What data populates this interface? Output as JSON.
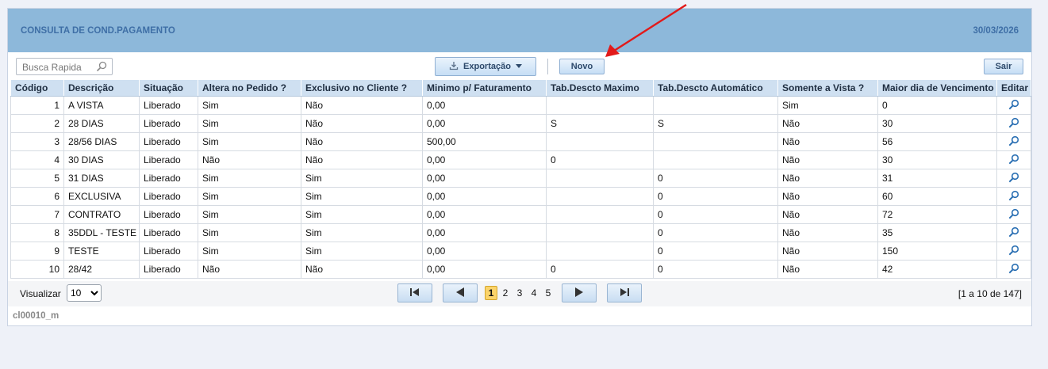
{
  "header": {
    "title": "CONSULTA DE COND.PAGAMENTO",
    "date": "30/03/2026"
  },
  "toolbar": {
    "search_placeholder": "Busca Rapida",
    "export_label": "Exportação",
    "novo_label": "Novo",
    "sair_label": "Sair"
  },
  "table": {
    "columns": [
      "Código",
      "Descrição",
      "Situação",
      "Altera no Pedido ?",
      "Exclusivo no Cliente ?",
      "Minimo p/ Faturamento",
      "Tab.Descto Maximo",
      "Tab.Descto Automático",
      "Somente a Vista ?",
      "Maior dia de Vencimento",
      "Editar"
    ],
    "rows": [
      [
        "1",
        "A VISTA",
        "Liberado",
        "Sim",
        "Não",
        "0,00",
        "",
        "",
        "Sim",
        "0"
      ],
      [
        "2",
        "28 DIAS",
        "Liberado",
        "Sim",
        "Não",
        "0,00",
        "S",
        "S",
        "Não",
        "30"
      ],
      [
        "3",
        "28/56 DIAS",
        "Liberado",
        "Sim",
        "Não",
        "500,00",
        "",
        "",
        "Não",
        "56"
      ],
      [
        "4",
        "30 DIAS",
        "Liberado",
        "Não",
        "Não",
        "0,00",
        "0",
        "",
        "Não",
        "30"
      ],
      [
        "5",
        "31 DIAS",
        "Liberado",
        "Sim",
        "Sim",
        "0,00",
        "",
        "0",
        "Não",
        "31"
      ],
      [
        "6",
        "EXCLUSIVA",
        "Liberado",
        "Sim",
        "Sim",
        "0,00",
        "",
        "0",
        "Não",
        "60"
      ],
      [
        "7",
        "CONTRATO",
        "Liberado",
        "Sim",
        "Sim",
        "0,00",
        "",
        "0",
        "Não",
        "72"
      ],
      [
        "8",
        "35DDL - TESTE",
        "Liberado",
        "Sim",
        "Sim",
        "0,00",
        "",
        "0",
        "Não",
        "35"
      ],
      [
        "9",
        "TESTE",
        "Liberado",
        "Sim",
        "Sim",
        "0,00",
        "",
        "0",
        "Não",
        "150"
      ],
      [
        "10",
        "28/42",
        "Liberado",
        "Não",
        "Não",
        "0,00",
        "0",
        "0",
        "Não",
        "42"
      ]
    ]
  },
  "pager": {
    "view_label": "Visualizar",
    "page_size": "10",
    "pages": [
      "1",
      "2",
      "3",
      "4",
      "5"
    ],
    "current_page": "1",
    "range_text": "[1 a 10 de 147]"
  },
  "footer": {
    "screen_id": "cl00010_m"
  },
  "colors": {
    "header_bg": "#8db8da",
    "header_text": "#3f6fa6",
    "accent_arrow": "#e21a1a",
    "page_current": "#fbd46b"
  },
  "icons": {
    "search": "magnifier-icon",
    "edit": "magnifier-edit-icon",
    "export": "download-icon"
  }
}
